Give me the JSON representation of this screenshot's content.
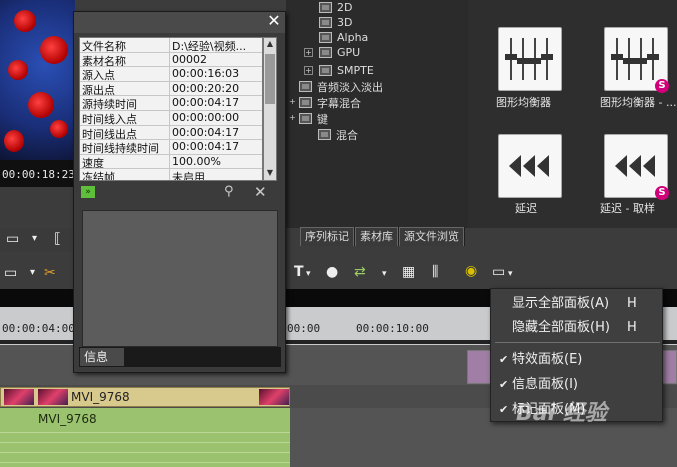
{
  "preview": {
    "timecode": "00:00:18:23"
  },
  "effect_tree": {
    "items": [
      {
        "label": "2D",
        "expand": ""
      },
      {
        "label": "3D",
        "expand": ""
      },
      {
        "label": "Alpha",
        "expand": ""
      },
      {
        "label": "GPU",
        "expand": "+"
      },
      {
        "label": "SMPTE",
        "expand": "+"
      },
      {
        "label": "音频淡入淡出",
        "expand": ""
      },
      {
        "label": "字幕混合",
        "expand": "+"
      },
      {
        "label": "键",
        "expand": "+"
      },
      {
        "label": "混合",
        "expand": ""
      }
    ]
  },
  "effects_grid": {
    "items": [
      {
        "label": "图形均衡器",
        "icon": "eq-icon",
        "badge": ""
      },
      {
        "label": "图形均衡器 - ...",
        "icon": "eq-icon",
        "badge": "S"
      },
      {
        "label": "延迟",
        "icon": "delay-icon",
        "badge": ""
      },
      {
        "label": "延迟 - 取样",
        "icon": "delay-icon",
        "badge": "S"
      }
    ]
  },
  "panel_tabs": [
    "序列标记",
    "素材库",
    "源文件浏览"
  ],
  "info_panel": {
    "close": "✕",
    "properties": [
      {
        "name": "文件名称",
        "value": "D:\\经验\\视频..."
      },
      {
        "name": "素材名称",
        "value": "00002"
      },
      {
        "name": "源入点",
        "value": "00:00:16:03"
      },
      {
        "name": "源出点",
        "value": "00:00:20:20"
      },
      {
        "name": "源持续时间",
        "value": "00:00:04:17"
      },
      {
        "name": "时间线入点",
        "value": "00:00:00:00"
      },
      {
        "name": "时间线出点",
        "value": "00:00:04:17"
      },
      {
        "name": "时间线持续时间",
        "value": "00:00:04:17"
      },
      {
        "name": "速度",
        "value": "100.00%"
      },
      {
        "name": "冻结帧",
        "value": "未启用"
      }
    ],
    "tab_label": "信息"
  },
  "ruler": {
    "ticks": [
      "00:00:04:00",
      "00:00",
      "00:00:10:00"
    ]
  },
  "timeline": {
    "clip_top_label": "MVI_9768",
    "clip_bottom_label": "MVI_9768"
  },
  "context_menu": {
    "items": [
      {
        "label": "显示全部面板(A)",
        "key": "H",
        "checked": false
      },
      {
        "label": "隐藏全部面板(H)",
        "key": "H",
        "checked": false
      },
      {
        "label": "特效面板(E)",
        "key": "",
        "checked": true
      },
      {
        "label": "信息面板(I)",
        "key": "",
        "checked": true
      },
      {
        "label": "标记面板(M)",
        "key": "",
        "checked": true
      }
    ]
  },
  "watermark": "Bai 经验",
  "colors": {
    "accent_badge": "#d1007a",
    "clip_audio": "#9bc36f",
    "clip_video": "#d8c98d"
  }
}
